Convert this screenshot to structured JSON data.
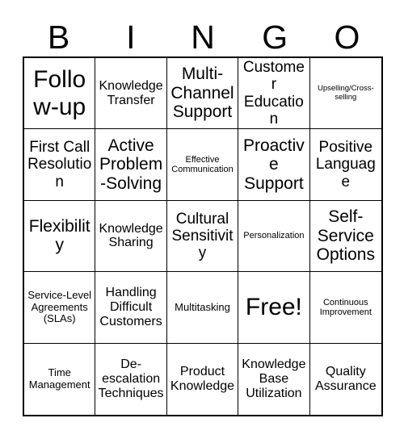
{
  "card": {
    "title": "BINGO",
    "header_letters": [
      "B",
      "I",
      "N",
      "G",
      "O"
    ],
    "colors": {
      "background": "#ffffff",
      "border": "#000000",
      "text": "#000000"
    },
    "grid_size": "5x5",
    "free_space_index": 12,
    "cells": [
      {
        "label": "Follow-up",
        "size": "xxl"
      },
      {
        "label": "Knowledge Transfer",
        "size": "md"
      },
      {
        "label": "Multi-Channel Support",
        "size": "xl"
      },
      {
        "label": "Customer Education",
        "size": "lg"
      },
      {
        "label": "Upselling/Cross-selling",
        "size": "xxs"
      },
      {
        "label": "First Call Resolution",
        "size": "lg"
      },
      {
        "label": "Active Problem-Solving",
        "size": "xl"
      },
      {
        "label": "Effective Communication",
        "size": "xs"
      },
      {
        "label": "Proactive Support",
        "size": "xl"
      },
      {
        "label": "Positive Language",
        "size": "lg"
      },
      {
        "label": "Flexibility",
        "size": "xl"
      },
      {
        "label": "Knowledge Sharing",
        "size": "md"
      },
      {
        "label": "Cultural Sensitivity",
        "size": "lg"
      },
      {
        "label": "Personalization",
        "size": "xs"
      },
      {
        "label": "Self-Service Options",
        "size": "xl"
      },
      {
        "label": "Service-Level Agreements (SLAs)",
        "size": "sm"
      },
      {
        "label": "Handling Difficult Customers",
        "size": "md"
      },
      {
        "label": "Multitasking",
        "size": "sm"
      },
      {
        "label": "Free!",
        "size": "xxl"
      },
      {
        "label": "Continuous Improvement",
        "size": "xs"
      },
      {
        "label": "Time Management",
        "size": "sm"
      },
      {
        "label": "De-escalation Techniques",
        "size": "md"
      },
      {
        "label": "Product Knowledge",
        "size": "md"
      },
      {
        "label": "Knowledge Base Utilization",
        "size": "md"
      },
      {
        "label": "Quality Assurance",
        "size": "md"
      }
    ]
  }
}
